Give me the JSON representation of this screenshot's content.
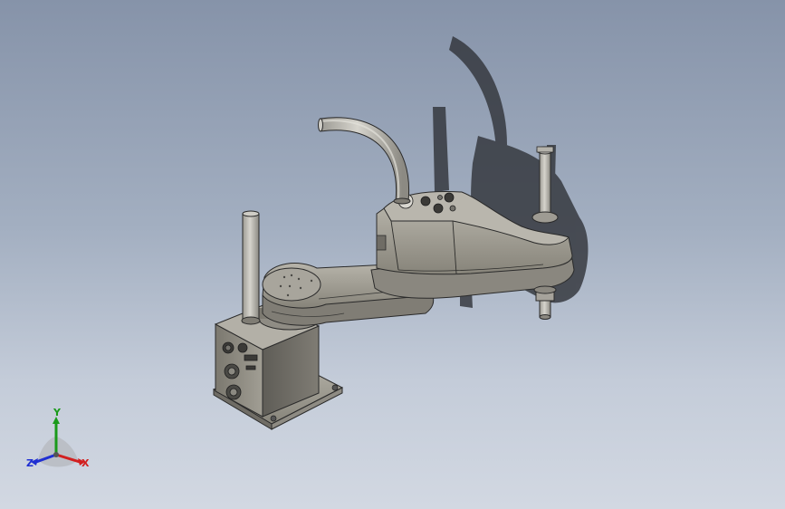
{
  "viewport": {
    "background_top": "#8693a9",
    "background_bottom": "#d2d8e2",
    "model": {
      "name": "scara-robot-model",
      "body_color": "#9a978c",
      "edge_color": "#2a2a2a",
      "shadow_color": "#2f3137"
    }
  },
  "triad": {
    "x_label": "X",
    "y_label": "Y",
    "z_label": "Z",
    "x_color": "#d21f1f",
    "y_color": "#1a9a1a",
    "z_color": "#1f2fd2"
  }
}
